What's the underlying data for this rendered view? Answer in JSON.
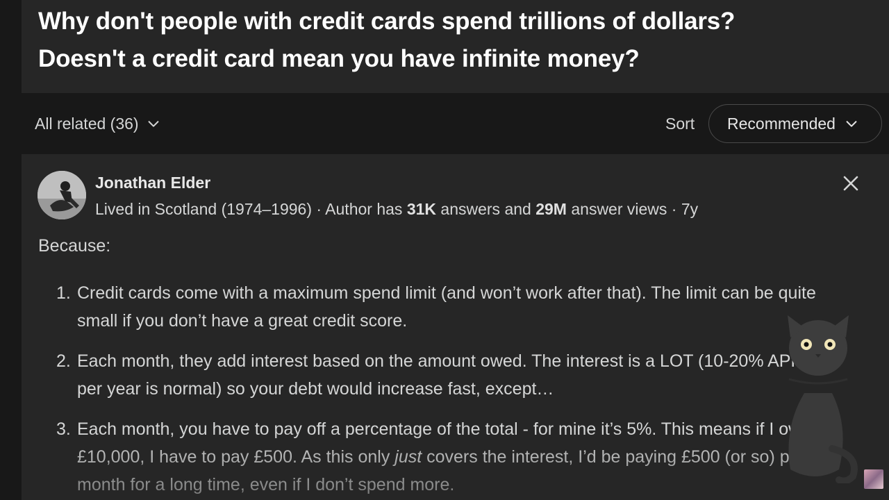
{
  "question": {
    "title_line1": "Why don't people with credit cards spend trillions of dollars?",
    "title_line2": "Doesn't a credit card mean you have infinite money?"
  },
  "filter": {
    "all_related_label": "All related (36)",
    "sort_label": "Sort",
    "sort_value": "Recommended"
  },
  "answer": {
    "author": "Jonathan Elder",
    "credential_prefix": "Lived in Scotland (1974–1996) · Author has ",
    "answers_count": "31K",
    "answers_text": " answers and ",
    "views_count": "29M",
    "views_text": " answer views · 7y",
    "intro": "Because:",
    "points": [
      {
        "num": "1.",
        "text": "Credit cards come with a maximum spend limit (and won’t work after that). The limit can be quite small if you don’t have a great credit score."
      },
      {
        "num": "2.",
        "text": "Each month, they add interest based on the amount owed. The interest is a LOT (10-20% APR per year is normal) so your debt would increase fast, except…"
      },
      {
        "num": "3.",
        "text_before": "Each month, you have to pay off a percentage of the total - for mine it’s 5%. This means if I owe £10,000, I have to pay £500. As this only ",
        "emphasis": "just",
        "text_after": " covers the interest, I’d be paying £500 (or so) per month for a long time, even if I don’t spend more."
      }
    ]
  },
  "icons": {
    "chevron": "chevron-down-icon",
    "close": "close-icon"
  },
  "colors": {
    "background": "#181818",
    "card": "#262626",
    "text": "#d5d6d6",
    "title": "#ffffff"
  }
}
